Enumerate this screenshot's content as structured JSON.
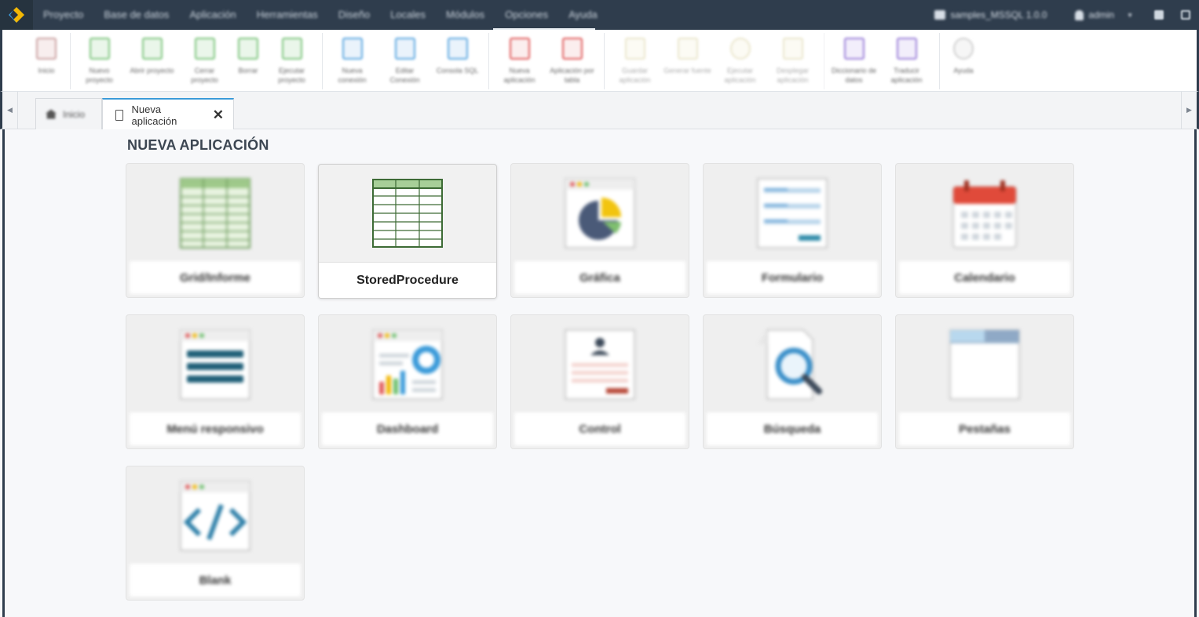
{
  "menubar": {
    "items": [
      "Proyecto",
      "Base de datos",
      "Aplicación",
      "Herramientas",
      "Diseño",
      "Locales",
      "Módulos",
      "Opciones",
      "Ayuda"
    ],
    "project": "samples_MSSQL 1.0.0",
    "user": "admin"
  },
  "toolbar": {
    "groups": [
      [
        {
          "label": "Inicio",
          "color": "#c9a0a0"
        }
      ],
      [
        {
          "label": "Nuevo proyecto",
          "color": "#6cbf6c"
        },
        {
          "label": "Abrir proyecto",
          "color": "#6cbf6c"
        },
        {
          "label": "Cerrar proyecto",
          "color": "#6cbf6c"
        },
        {
          "label": "Borrar",
          "color": "#6cbf6c"
        },
        {
          "label": "Ejecutar proyecto",
          "color": "#6cbf6c"
        }
      ],
      [
        {
          "label": "Nueva conexión",
          "color": "#5aa6e0"
        },
        {
          "label": "Editar Conexión",
          "color": "#5aa6e0"
        },
        {
          "label": "Consola SQL",
          "color": "#5aa6e0"
        }
      ],
      [
        {
          "label": "Nueva aplicación",
          "color": "#e05a5a"
        },
        {
          "label": "Aplicación por tabla",
          "color": "#e05a5a"
        }
      ],
      [
        {
          "label": "Guardar aplicación",
          "color": "#d8d0a0"
        },
        {
          "label": "Generar fuente",
          "color": "#d8d0a0"
        },
        {
          "label": "Ejecutar aplicación",
          "color": "#d8d0a0"
        },
        {
          "label": "Desplegar aplicación",
          "color": "#d8d0a0"
        }
      ],
      [
        {
          "label": "Diccionario de datos",
          "color": "#9a7fd8"
        },
        {
          "label": "Traducir aplicación",
          "color": "#9a7fd8"
        }
      ],
      [
        {
          "label": "Ayuda",
          "color": "#cfcfcf"
        }
      ]
    ]
  },
  "tabs": {
    "home_label": "Inicio",
    "active_label": "Nueva aplicación"
  },
  "main": {
    "title": "NUEVA APLICACIÓN",
    "cards": [
      {
        "label": "Grid/Informe",
        "icon": "grid-icon"
      },
      {
        "label": "StoredProcedure",
        "icon": "stored-procedure-icon"
      },
      {
        "label": "Gráfica",
        "icon": "chart-icon"
      },
      {
        "label": "Formulario",
        "icon": "form-icon"
      },
      {
        "label": "Calendario",
        "icon": "calendar-icon"
      },
      {
        "label": "Menú responsivo",
        "icon": "responsive-menu-icon"
      },
      {
        "label": "Dashboard",
        "icon": "dashboard-icon"
      },
      {
        "label": "Control",
        "icon": "control-icon"
      },
      {
        "label": "Búsqueda",
        "icon": "search-icon"
      },
      {
        "label": "Pestañas",
        "icon": "tabs-icon"
      },
      {
        "label": "Blank",
        "icon": "blank-code-icon"
      }
    ]
  }
}
